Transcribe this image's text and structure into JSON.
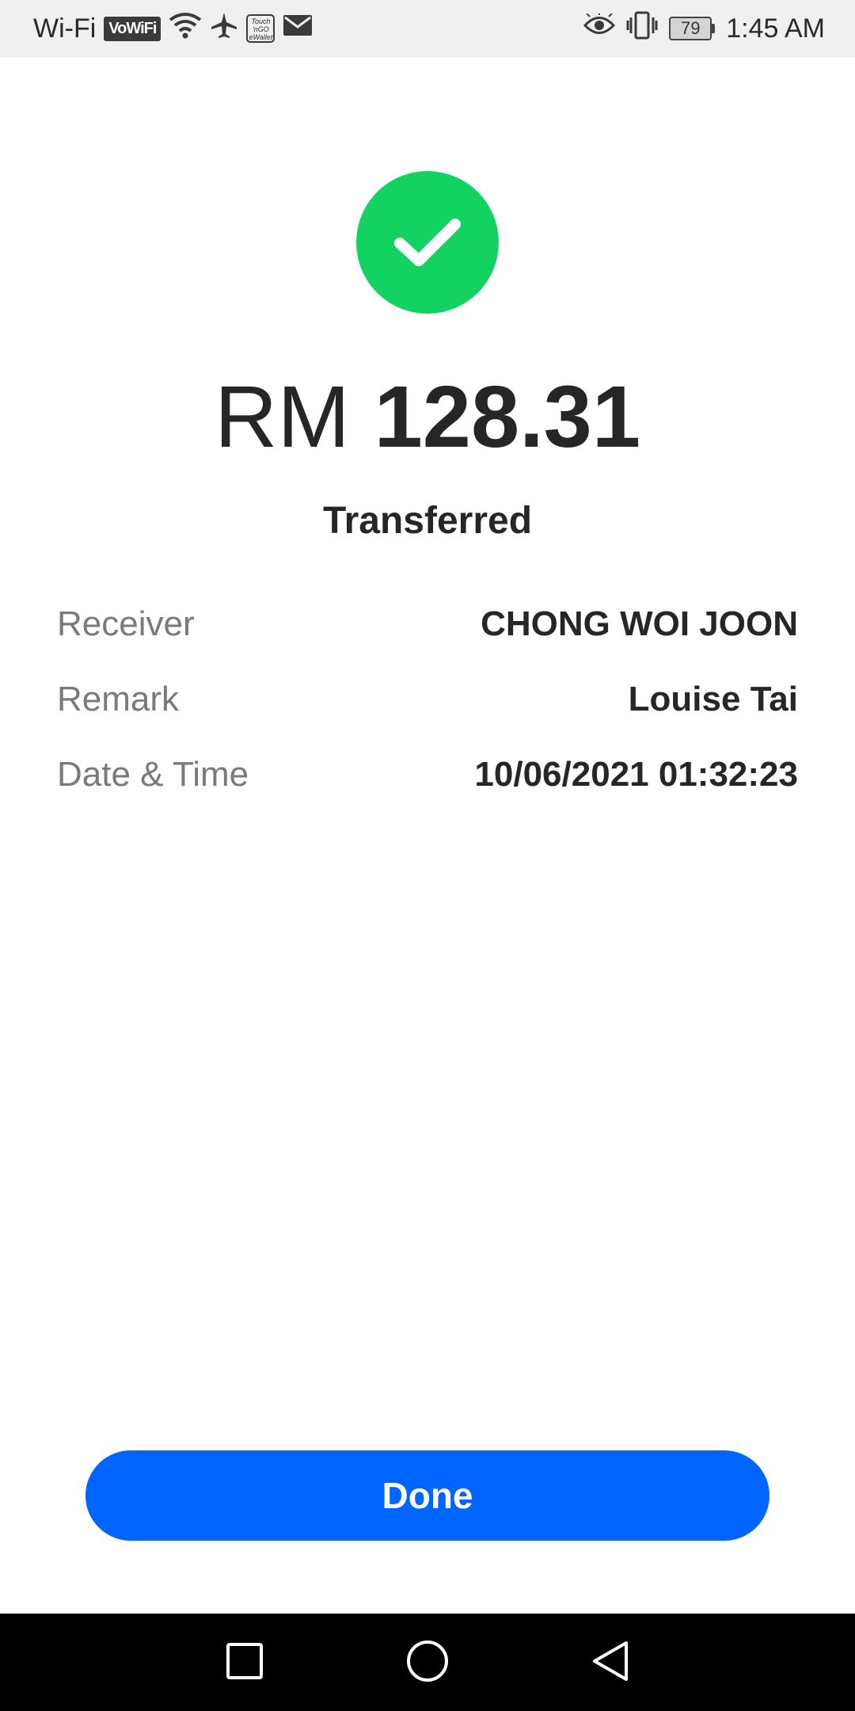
{
  "status_bar": {
    "carrier": "Wi-Fi",
    "vowifi": "VoWiFi",
    "tng_line1": "Touch",
    "tng_line2": "'nGO",
    "tng_line3": "eWallet",
    "battery": "79",
    "time": "1:45 AM"
  },
  "transaction": {
    "currency": "RM",
    "amount": "128.31",
    "status": "Transferred",
    "success_color": "#12d361"
  },
  "details": [
    {
      "label": "Receiver",
      "value": "CHONG WOI JOON"
    },
    {
      "label": "Remark",
      "value": "Louise Tai"
    },
    {
      "label": "Date & Time",
      "value": "10/06/2021 01:32:23"
    }
  ],
  "actions": {
    "done_label": "Done",
    "accent": "#0064ff"
  },
  "nav": {
    "recents_icon": "square-icon",
    "home_icon": "circle-icon",
    "back_icon": "triangle-back-icon"
  }
}
